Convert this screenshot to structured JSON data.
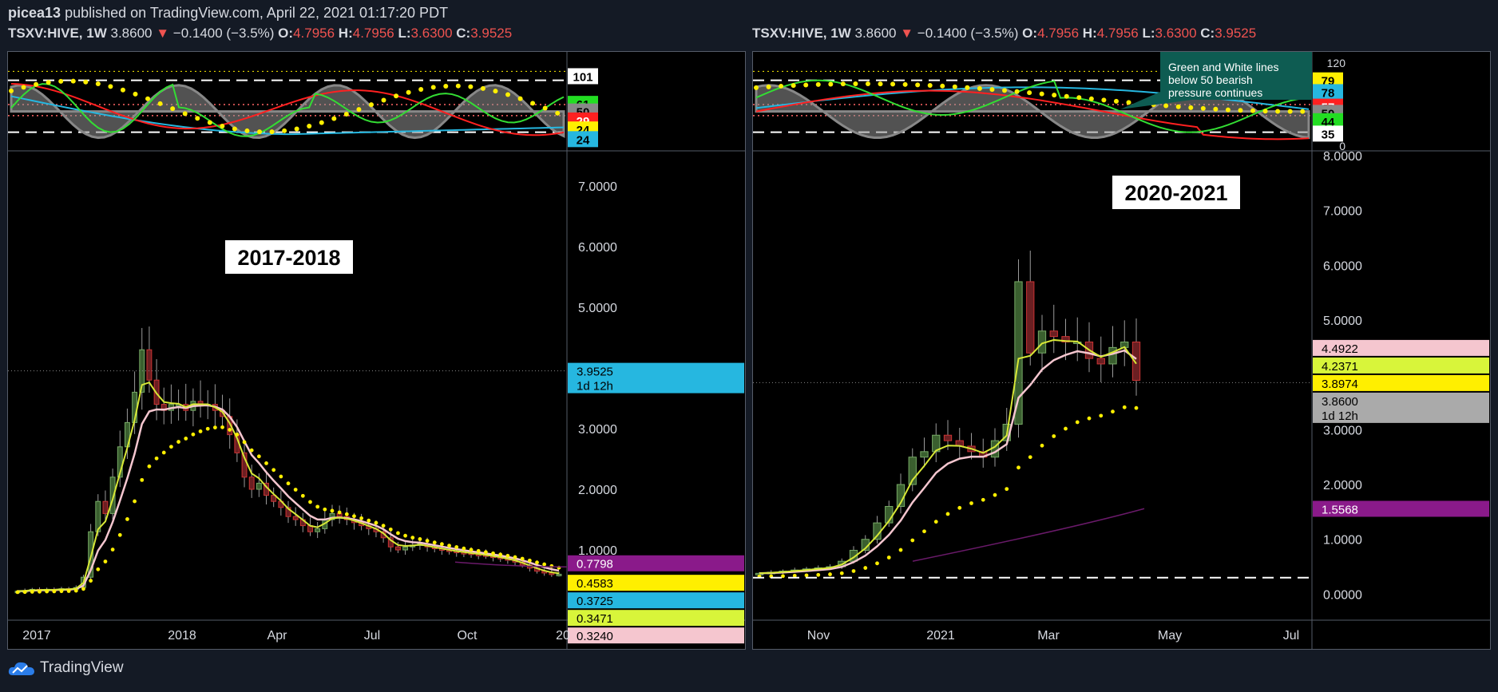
{
  "header": {
    "author": "picea13",
    "published_text": "published on TradingView.com, April 22, 2021 01:17:20 PDT"
  },
  "symbol_line": {
    "symbol": "TSXV:HIVE, 1W",
    "price": "3.8600",
    "arrow": "▼",
    "change": "−0.1400 (−3.5%)",
    "o_label": "O:",
    "o_value": "4.7956",
    "h_label": "H:",
    "h_value": "4.7956",
    "l_label": "L:",
    "l_value": "3.6300",
    "c_label": "C:",
    "c_value": "3.9525"
  },
  "footer": {
    "brand": "TradingView"
  },
  "colors": {
    "background": "#000000",
    "up_candle": "#3a5f2f",
    "down_candle": "#6b1f22",
    "ema_yellow": "#d8e836",
    "ema_pink": "#f5c6cf",
    "dots": "#ffef00",
    "sma_purple": "#6a1a6a",
    "osc_green": "#33dd33",
    "osc_red": "#ff2020",
    "osc_blue": "#26b7e0",
    "osc_gray": "#888888"
  },
  "chart_data": [
    {
      "type": "candlestick",
      "annotation": "2017-2018",
      "x_tick_labels": [
        "2017",
        "2018",
        "Apr",
        "Jul",
        "Oct",
        "20"
      ],
      "price_axis": [
        "7.0000",
        "6.0000",
        "5.0000",
        "3.0000",
        "2.0000",
        "1.0000"
      ],
      "ylim": [
        0,
        7.5
      ],
      "price_badges": [
        {
          "value": "3.9525",
          "sub": "1d 12h",
          "y": 3.9525,
          "color": "#26b7e0",
          "text": "#000"
        },
        {
          "value": "0.7798",
          "y": 0.7798,
          "color": "#8a1a8a",
          "text": "#fff"
        },
        {
          "value": "0.4583",
          "y": 0.4583,
          "color": "#ffef00",
          "text": "#000"
        },
        {
          "value": "0.3725",
          "y": 0.3725,
          "color": "#26b7e0",
          "text": "#000"
        },
        {
          "value": "0.3471",
          "y": 0.3471,
          "color": "#d8f53a",
          "text": "#000"
        },
        {
          "value": "0.3240",
          "y": 0.1,
          "color": "#f5c6cf",
          "text": "#000"
        }
      ],
      "closes": [
        0.32,
        0.33,
        0.35,
        0.34,
        0.35,
        0.34,
        0.36,
        0.35,
        0.38,
        0.55,
        1.3,
        1.8,
        1.6,
        2.2,
        2.7,
        3.1,
        3.6,
        4.3,
        3.8,
        3.4,
        3.3,
        3.4,
        3.4,
        3.3,
        3.45,
        3.4,
        3.4,
        3.3,
        3.2,
        2.9,
        2.6,
        2.2,
        2.0,
        2.1,
        1.9,
        1.8,
        1.7,
        1.55,
        1.5,
        1.4,
        1.3,
        1.35,
        1.5,
        1.6,
        1.55,
        1.5,
        1.45,
        1.4,
        1.35,
        1.3,
        1.2,
        1.05,
        1.0,
        1.05,
        1.08,
        1.1,
        1.05,
        1.02,
        1.0,
        0.98,
        0.96,
        0.95,
        0.93,
        0.92,
        0.9,
        0.88,
        0.86,
        0.83,
        0.8,
        0.75,
        0.7,
        0.65,
        0.62,
        0.6,
        0.6
      ],
      "osc_badges": [
        {
          "value": "101",
          "y": 101,
          "color": "#ffffff",
          "text": "#000"
        },
        {
          "value": "61",
          "y": 61,
          "color": "#22dd22",
          "text": "#000"
        },
        {
          "value": "50",
          "y": 50,
          "color": "#888",
          "text": "#000"
        },
        {
          "value": "29",
          "y": 37,
          "color": "#ff2020",
          "text": "#fff"
        },
        {
          "value": "24",
          "y": 24,
          "color": "#ffef00",
          "text": "#000"
        },
        {
          "value": "24",
          "y": 10,
          "color": "#26b7e0",
          "text": "#000"
        }
      ]
    },
    {
      "type": "candlestick",
      "annotation": "2020-2021",
      "x_tick_labels": [
        "Nov",
        "2021",
        "Mar",
        "May",
        "Jul"
      ],
      "price_axis": [
        "8.0000",
        "7.0000",
        "6.0000",
        "5.0000",
        "3.0000",
        "2.0000",
        "1.0000",
        "0.0000"
      ],
      "ylim": [
        -0.3,
        8.0
      ],
      "price_badges": [
        {
          "value": "4.4922",
          "y": 4.4922,
          "color": "#f5c6cf",
          "text": "#000"
        },
        {
          "value": "4.2371",
          "y": 4.2371,
          "color": "#d8f53a",
          "text": "#000"
        },
        {
          "value": "3.8974",
          "y": 3.8974,
          "color": "#ffef00",
          "text": "#000"
        },
        {
          "value": "3.8600",
          "sub": "1d 12h",
          "y": 3.86,
          "color": "#aaaaaa",
          "text": "#000"
        },
        {
          "value": "1.5568",
          "y": 1.5568,
          "color": "#8a1a8a",
          "text": "#fff"
        }
      ],
      "closes": [
        0.38,
        0.4,
        0.42,
        0.44,
        0.46,
        0.48,
        0.5,
        0.6,
        0.8,
        1.0,
        1.3,
        1.6,
        2.0,
        2.5,
        2.6,
        2.9,
        2.8,
        2.7,
        2.6,
        2.5,
        2.8,
        3.1,
        5.7,
        4.4,
        4.8,
        4.7,
        4.6,
        4.6,
        4.3,
        4.2,
        4.5,
        4.6,
        3.9
      ],
      "osc_badges": [
        {
          "value": "79",
          "y": 95,
          "color": "#ffef00",
          "text": "#000"
        },
        {
          "value": "78",
          "y": 78,
          "color": "#26b7e0",
          "text": "#000"
        },
        {
          "value": "57",
          "y": 57,
          "color": "#ff2020",
          "text": "#fff"
        },
        {
          "value": "50",
          "y": 48,
          "color": "#888",
          "text": "#000"
        },
        {
          "value": "44",
          "y": 36,
          "color": "#22dd22",
          "text": "#000"
        },
        {
          "value": "35",
          "y": 18,
          "color": "#ffffff",
          "text": "#000"
        }
      ],
      "osc_axis": [
        "120",
        "0"
      ],
      "note": "Green and White lines below 50 bearish pressure continues"
    }
  ]
}
